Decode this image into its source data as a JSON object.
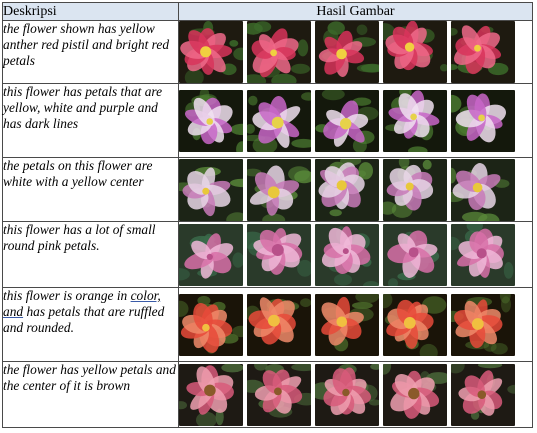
{
  "table": {
    "header": {
      "description": "Deskripsi",
      "images": "Hasil Gambar"
    },
    "rows": [
      {
        "description": "the flower shown has yellow anther red pistil and bright red petals",
        "palette": {
          "bg": "#1e1a10",
          "petal": "#d8345a",
          "petal2": "#f06a8a",
          "center": "#f0d040",
          "leaf": "#3c6a2a"
        }
      },
      {
        "description": "this flower has petals that are yellow, white and purple and has dark lines",
        "palette": {
          "bg": "#14180c",
          "petal": "#c866c8",
          "petal2": "#f0e0f0",
          "center": "#e6d24a",
          "leaf": "#4a7a30"
        }
      },
      {
        "description": "the petals on this flower are white with a yellow center",
        "palette": {
          "bg": "#1c2416",
          "petal": "#e8d6e6",
          "petal2": "#c87ab8",
          "center": "#e8c83a",
          "leaf": "#5a8a3a"
        }
      },
      {
        "description": "this flower has a lot of small round pink petals.",
        "palette": {
          "bg": "#2a3a2a",
          "petal": "#d870a8",
          "petal2": "#f0b8d8",
          "center": "#b8508a",
          "leaf": "#3a6a4a"
        }
      },
      {
        "description_parts": [
          "this flower is orange in ",
          "color, and",
          " has petals that are ruffled and rounded."
        ],
        "palette": {
          "bg": "#1a1408",
          "petal": "#e84a3a",
          "petal2": "#f08a6a",
          "center": "#f0c040",
          "leaf": "#4a6a2a"
        }
      },
      {
        "description": "the flower has yellow petals and the center of it is brown",
        "palette": {
          "bg": "#1e1a14",
          "petal": "#d85a7a",
          "petal2": "#f0a0b0",
          "center": "#8a5a2a",
          "leaf": "#4a6a3a"
        }
      }
    ]
  }
}
